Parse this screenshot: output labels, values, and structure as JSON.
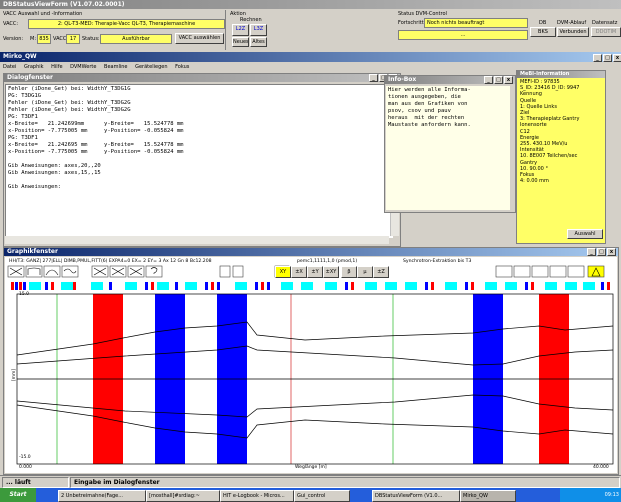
{
  "app_title": "DBStatusViewForm (V1.07.02.0001)",
  "vacc": {
    "group_title": "VACC Auswahl und -Information",
    "vacc_label": "VACC:",
    "vacc_value": "2: QL-T3-MED: Therapie-Vacc QL-T3, Therapiemaschine",
    "version_label": "Version:",
    "version_m_label": "M:",
    "version_m_value": "835",
    "vacc_num_label": "VACC",
    "vacc_num_value": "17",
    "status_label": "Status:",
    "status_value": "Ausführbar",
    "select_button": "VACC auswählen"
  },
  "aktion": {
    "title": "Aktion",
    "rechnen_label": "Rechnen",
    "btn1": "L2Z",
    "btn2": "L3Z",
    "neues": "Neues",
    "altes": "Altes"
  },
  "dvm": {
    "title": "Status DVM-Control",
    "fortschritt_label": "Fortschritt:",
    "fortschritt_value": "Noch nichts beauftragt",
    "progress_value": "...",
    "db_label": "DB",
    "db_button": "BKS",
    "ablauf_label": "DVM-Ablauf",
    "ablauf_button": "Verbunden",
    "datensatz_label": "Datensatz",
    "datensatz_button": "DDOTIM"
  },
  "mirko_title": "Mirko_QW",
  "menu": [
    "Datei",
    "Graphik",
    "Hilfe",
    "DVMWerte",
    "Beamline",
    "Geräteliegen",
    "Fokus"
  ],
  "dialog": {
    "title": "Dialogfenster",
    "lines": [
      "Fehler (iDone_Get) bei: WidthY_T3DG1G",
      "PG: T3DG1G",
      "Fehler (iDone_Get) bei: WidthY_T3DG2G",
      "Fehler (iDone_Get) bei: WidthY_T3DG2G",
      "PG: T3DF1",
      "x-Breite=   21.242699mm      y-Breite=   15.524778 mm",
      "x-Position= -7.775005 mm     y-Position= -0.055824 mm",
      "PG: T3DF1",
      "x-Breite=   21.242695 mm     y-Breite=   15.524778 mm",
      "x-Position= -7.775005 mm     y-Position= -0.055824 mm",
      "",
      "Gib Anweisungen: axes,20,,20",
      "Gib Anweisungen: axes,15,,15",
      "",
      "Gib Anweisungen:"
    ]
  },
  "info": {
    "title": "Info-Box",
    "lines": [
      "Hier werden alle Informa-",
      "tionen ausgegeben, die",
      "man aus den Grafiken von",
      "psov, csov und pauv",
      "heraus  mit der rechten",
      "Maustaste anfordern kann."
    ]
  },
  "mebi": {
    "title": "MeBI-Information",
    "lines": [
      "MEFI-ID :  97835",
      "S_ID: 23416    D_ID: 9947",
      "Kennung",
      "Quelle",
      "1: Quelle Links",
      "Ziel",
      "3: Therapieplatz Gantry",
      "Ionensorte",
      "C12",
      "Energie",
      "255. 430.10 MeV/u",
      "Intensität",
      "10. 8E007 Teilchen/sec",
      "Gantry",
      "10. 90.00 °",
      "Fokus",
      "4: 0.00 mm"
    ],
    "button": "Auswahl"
  },
  "graph": {
    "title": "Graphikfenster",
    "header_left": "HH/T3: GANZ| 277|ELL| DIMB,PMUL,FITT(6) EXPA4=0 EX= 2 EY= 3 Ax 12 Gn 8 Bc12.208",
    "header_mid": "pemc1,1111,1,0  (pmod,1)",
    "header_right": "Synchrotron-Extraktion bis T3",
    "toolbar_buttons": [
      "XY",
      "±X",
      "±Y",
      "±XY",
      "β",
      "μ",
      "±Z"
    ],
    "ylabel": "[mm]",
    "xlabel": "Weglänge [m]",
    "x_left": "0.000",
    "x_right": "40.000",
    "y_top": "15.0",
    "y_bottom": "-15.0"
  },
  "status": {
    "state": "... läuft",
    "prompt": "Eingabe im Dialogfenster"
  },
  "taskbar": {
    "start": "Start",
    "items": [
      "2 Unbetreimahne(Fage...",
      "[mosthall]#srdiag:~",
      "HIT e-Logbook - Micros...",
      "Gui_control",
      "DBStatusViewForm (V1.0...",
      "Mirko_QW"
    ],
    "clock": "09:13"
  },
  "colors": {
    "red": "#ff0000",
    "blue": "#0000ff",
    "yellow": "#ffff66",
    "title": "#0a246a"
  }
}
